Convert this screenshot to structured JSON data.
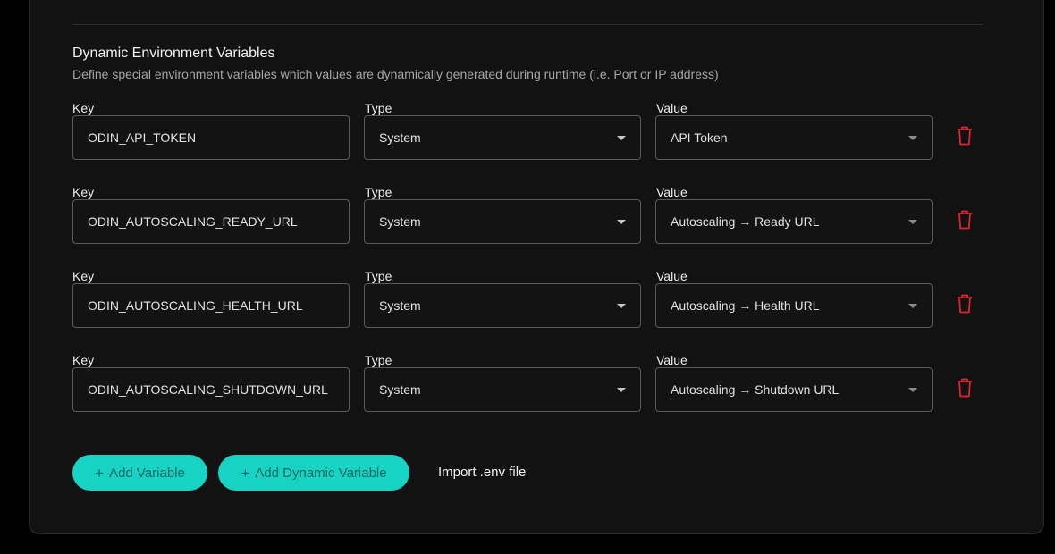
{
  "section": {
    "title": "Dynamic Environment Variables",
    "description": "Define special environment variables which values are dynamically generated during runtime (i.e. Port or IP address)"
  },
  "labels": {
    "key": "Key",
    "type": "Type",
    "value": "Value"
  },
  "rows": [
    {
      "key": "ODIN_API_TOKEN",
      "type": "System",
      "value": "API Token"
    },
    {
      "key": "ODIN_AUTOSCALING_READY_URL",
      "type": "System",
      "value": "Autoscaling → Ready URL"
    },
    {
      "key": "ODIN_AUTOSCALING_HEALTH_URL",
      "type": "System",
      "value": "Autoscaling → Health URL"
    },
    {
      "key": "ODIN_AUTOSCALING_SHUTDOWN_URL",
      "type": "System",
      "value": "Autoscaling → Shutdown URL"
    }
  ],
  "actions": {
    "add_variable": "Add Variable",
    "add_dynamic_variable": "Add Dynamic Variable",
    "import_env": "Import .env file",
    "plus": "+"
  },
  "icons": {
    "delete": "trash-icon",
    "dropdown": "caret-down-icon",
    "add": "plus-icon"
  },
  "colors": {
    "accent": "#16d3c4",
    "accent_text": "#0a6a62",
    "danger": "#e0242f",
    "background": "#121212"
  }
}
